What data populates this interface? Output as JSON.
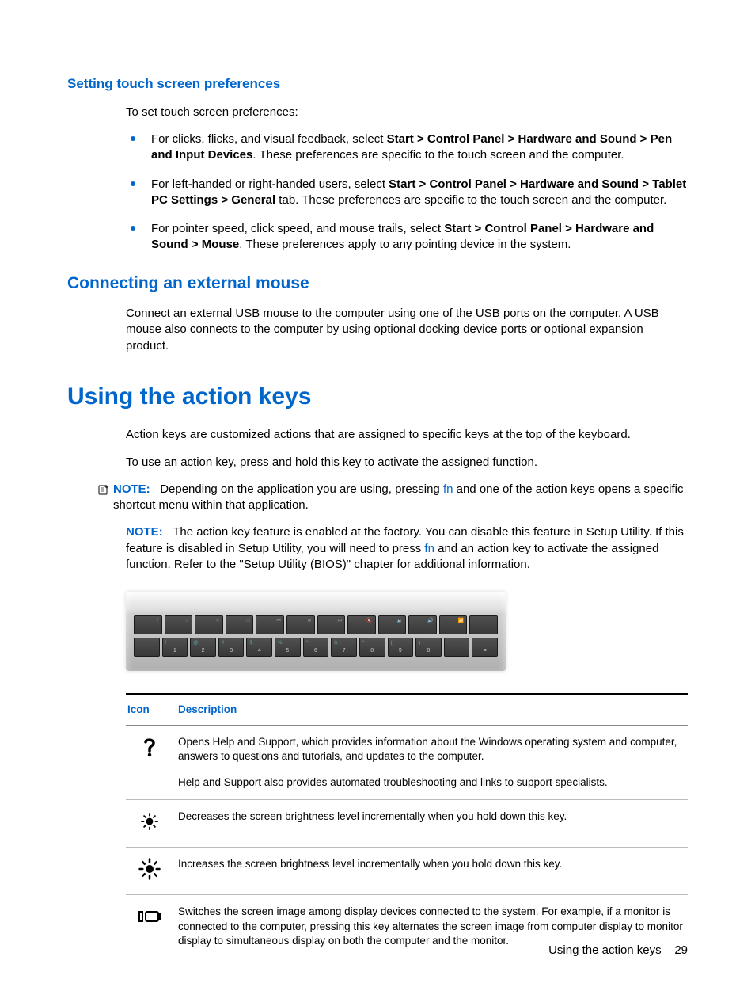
{
  "section1": {
    "heading": "Setting touch screen preferences",
    "intro": "To set touch screen preferences:",
    "bullets": [
      {
        "pre": "For clicks, flicks, and visual feedback, select ",
        "bold": "Start > Control Panel > Hardware and Sound > Pen and Input Devices",
        "post": ". These preferences are specific to the touch screen and the computer."
      },
      {
        "pre": "For left-handed or right-handed users, select ",
        "bold": "Start > Control Panel > Hardware and Sound > Tablet PC Settings > General",
        "post": " tab. These preferences are specific to the touch screen and the computer."
      },
      {
        "pre": "For pointer speed, click speed, and mouse trails, select ",
        "bold": "Start > Control Panel > Hardware and Sound > Mouse",
        "post": ". These preferences apply to any pointing device in the system."
      }
    ]
  },
  "section2": {
    "heading": "Connecting an external mouse",
    "para": "Connect an external USB mouse to the computer using one of the USB ports on the computer. A USB mouse also connects to the computer by using optional docking device ports or optional expansion product."
  },
  "section3": {
    "heading": "Using the action keys",
    "para1": "Action keys are customized actions that are assigned to specific keys at the top of the keyboard.",
    "para2": "To use an action key, press and hold this key to activate the assigned function.",
    "note1": {
      "label": "NOTE:",
      "pre": "Depending on the application you are using, pressing ",
      "fn": "fn",
      "post": " and one of the action keys opens a specific shortcut menu within that application."
    },
    "note2": {
      "label": "NOTE:",
      "pre": "The action key feature is enabled at the factory. You can disable this feature in Setup Utility. If this feature is disabled in Setup Utility, you will need to press ",
      "fn": "fn",
      "post": " and an action key to activate the assigned function. Refer to the \"Setup Utility (BIOS)\" chapter for additional information."
    }
  },
  "table": {
    "headers": {
      "icon": "Icon",
      "desc": "Description"
    },
    "rows": [
      {
        "icon": "help-icon",
        "desc1": "Opens Help and Support, which provides information about the Windows operating system and computer, answers to questions and tutorials, and updates to the computer.",
        "desc2": "Help and Support also provides automated troubleshooting and links to support specialists."
      },
      {
        "icon": "brightness-down-icon",
        "desc1": "Decreases the screen brightness level incrementally when you hold down this key."
      },
      {
        "icon": "brightness-up-icon",
        "desc1": "Increases the screen brightness level incrementally when you hold down this key."
      },
      {
        "icon": "display-switch-icon",
        "desc1": "Switches the screen image among display devices connected to the system. For example, if a monitor is connected to the computer, pressing this key alternates the screen image from computer display to monitor display to simultaneous display on both the computer and the monitor."
      }
    ]
  },
  "keyboard": {
    "row1_sym": [
      "?",
      "☼",
      "☀",
      "⌐",
      "⏮",
      "⏯",
      "⏭",
      "🔇",
      "🔉",
      "🔊",
      "✈"
    ],
    "row2": [
      "~",
      "1",
      "2",
      "3",
      "4",
      "5",
      "6",
      "7",
      "8",
      "9",
      "0",
      "-",
      "="
    ]
  },
  "footer": {
    "text": "Using the action keys",
    "page": "29"
  }
}
